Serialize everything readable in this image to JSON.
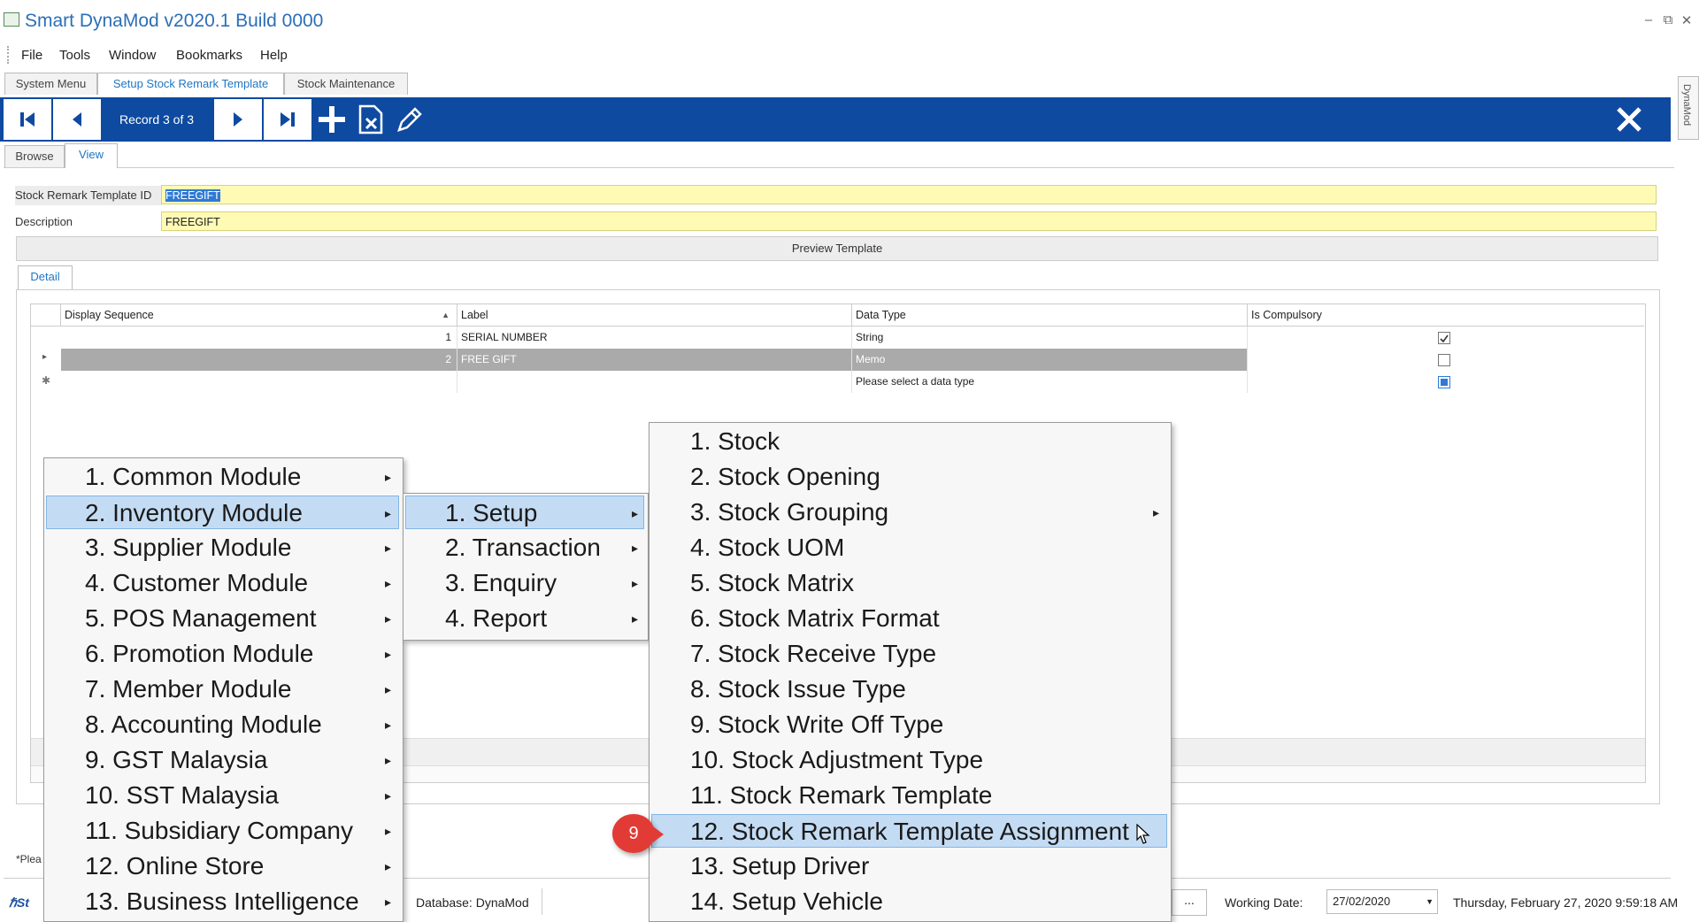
{
  "app": {
    "title": "Smart DynaMod v2020.1 Build 0000"
  },
  "menubar": [
    "File",
    "Tools",
    "Window",
    "Bookmarks",
    "Help"
  ],
  "tabs": [
    "System Menu",
    "Setup Stock Remark Template",
    "Stock Maintenance"
  ],
  "toolbar": {
    "record": "Record 3 of 3"
  },
  "side_tab": "DynaMod",
  "view_tabs": [
    "Browse",
    "View"
  ],
  "form": {
    "id_label": "Stock Remark Template ID",
    "id_value": "FREEGIFT",
    "desc_label": "Description",
    "desc_value": "FREEGIFT",
    "preview_button": "Preview Template",
    "detail_tab": "Detail"
  },
  "grid": {
    "columns": [
      "Display Sequence",
      "Label",
      "Data Type",
      "Is Compulsory"
    ],
    "rows": [
      {
        "seq": "1",
        "label": "SERIAL NUMBER",
        "type": "String",
        "compulsory": true
      },
      {
        "seq": "2",
        "label": "FREE GIFT",
        "type": "Memo",
        "compulsory": false
      },
      {
        "seq": "",
        "label": "",
        "type": "Please select a data type",
        "compulsory": true
      }
    ]
  },
  "menus": {
    "main": [
      "1. Common Module",
      "2. Inventory Module",
      "3. Supplier Module",
      "4. Customer Module",
      "5. POS Management",
      "6. Promotion Module",
      "7. Member Module",
      "8. Accounting Module",
      "9. GST Malaysia",
      "10. SST Malaysia",
      "11. Subsidiary Company",
      "12. Online Store",
      "13. Business Intelligence"
    ],
    "inventory": [
      "1. Setup",
      "2. Transaction",
      "3. Enquiry",
      "4. Report"
    ],
    "setup": [
      "1. Stock",
      "2. Stock Opening",
      "3. Stock Grouping",
      "4. Stock UOM",
      "5. Stock Matrix",
      "6. Stock Matrix Format",
      "7. Stock Receive Type",
      "8. Stock Issue Type",
      "9. Stock Write Off Type",
      "10. Stock Adjustment Type",
      "11. Stock Remark Template",
      "12. Stock Remark Template Assignment",
      "13. Setup Driver",
      "14. Setup Vehicle"
    ]
  },
  "step_badge": "9",
  "status": {
    "left_note": "*Plea",
    "database": "Database: DynaMod",
    "working_date_label": "Working Date:",
    "working_date": "27/02/2020",
    "datetime": "Thursday, February 27, 2020 9:59:18 AM",
    "ellipsis": "..."
  },
  "colors": {
    "toolbar": "#0e4aa0",
    "highlight": "#c4dcf3",
    "field": "#fffbb5",
    "accent": "#1f76c2",
    "badge": "#e23b36"
  }
}
